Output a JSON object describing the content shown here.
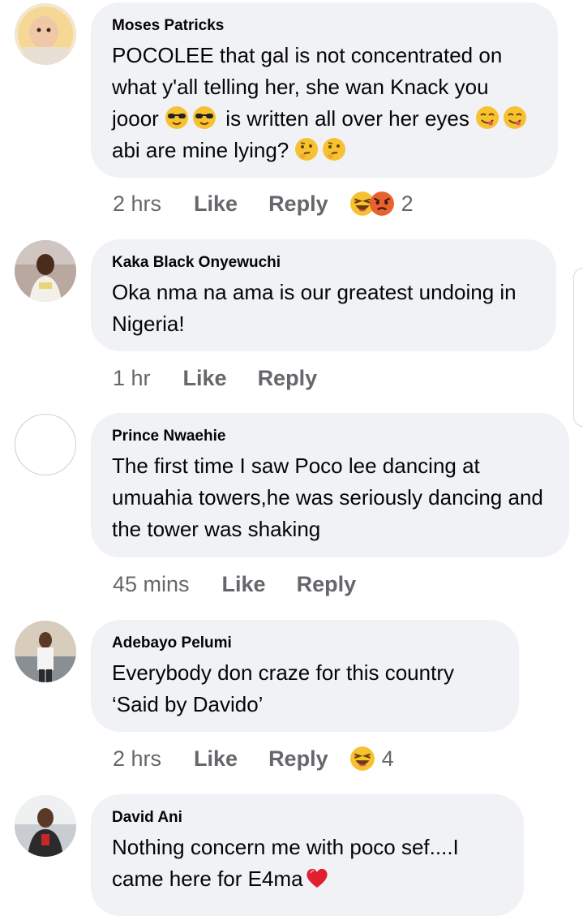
{
  "comments": [
    {
      "name": "Moses Patricks",
      "text_a": "POCOLEE that gal is not concentrated on what y'all telling her, she wan Knack you jooor",
      "text_b": "is written all over her eyes",
      "text_c": "abi are mine lying?",
      "time": "2 hrs",
      "like": "Like",
      "reply": "Reply",
      "reaction_count": "2",
      "reactions": [
        "laughing-emoji",
        "angry-emoji"
      ]
    },
    {
      "name": "Kaka Black Onyewuchi",
      "text": "Oka nma na ama is our greatest undoing in Nigeria!",
      "time": "1 hr",
      "like": "Like",
      "reply": "Reply"
    },
    {
      "name": "Prince Nwaehie",
      "text": "The first time I saw Poco lee dancing at umuahia towers,he was seriously dancing and the tower was shaking",
      "time": "45 mins",
      "like": "Like",
      "reply": "Reply"
    },
    {
      "name": "Adebayo Pelumi",
      "text_line1": "Everybody don craze for this country",
      "text_line2": "‘Said by Davido’",
      "time": "2 hrs",
      "like": "Like",
      "reply": "Reply",
      "reaction_count": "4",
      "reactions": [
        "laughing-emoji"
      ]
    },
    {
      "name": "David Ani",
      "text": "Nothing concern me with poco sef....I came here for E4ma",
      "trailing_emoji": "red-heart-emoji"
    }
  ],
  "colors": {
    "bubble": "#f0f2f5",
    "name": "#050505",
    "meta": "#65676b"
  }
}
